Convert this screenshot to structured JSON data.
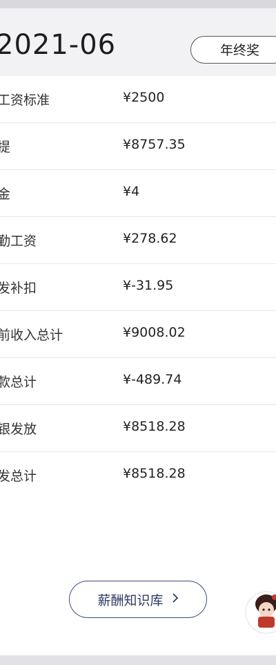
{
  "header": {
    "period": "2021-06",
    "bonus_button": "年终奖"
  },
  "rows": [
    {
      "label": "工资标准",
      "value": "¥2500"
    },
    {
      "label": "提",
      "value": "¥8757.35"
    },
    {
      "label": "金",
      "value": "¥4"
    },
    {
      "label": "勤工资",
      "value": "¥278.62"
    },
    {
      "label": "发补扣",
      "value": "¥-31.95"
    },
    {
      "label": "前收入总计",
      "value": "¥9008.02"
    },
    {
      "label": "款总计",
      "value": "¥-489.74"
    },
    {
      "label": "银发放",
      "value": "¥8518.28"
    },
    {
      "label": "发总计",
      "value": "¥8518.28"
    }
  ],
  "footer": {
    "knowledge_button": "薪酬知识库",
    "chevron_icon": "chevron-right-icon"
  },
  "colors": {
    "button_border": "#3b4b7a",
    "background": "#e9e9ed"
  }
}
